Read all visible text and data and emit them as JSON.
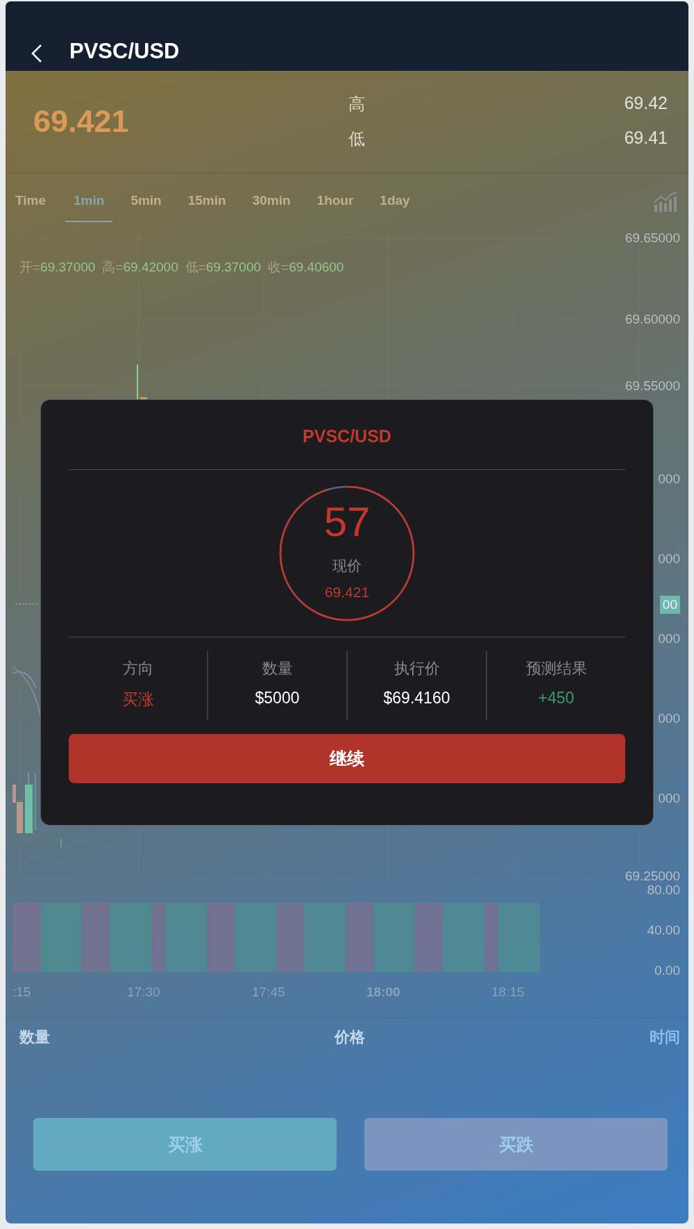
{
  "header": {
    "title": "PVSC/USD"
  },
  "quote": {
    "price": "69.421",
    "high_label": "高",
    "high": "69.42",
    "low_label": "低",
    "low": "69.41"
  },
  "intervals": [
    {
      "label": "Time",
      "selected": false
    },
    {
      "label": "1min",
      "selected": true
    },
    {
      "label": "5min",
      "selected": false
    },
    {
      "label": "15min",
      "selected": false
    },
    {
      "label": "30min",
      "selected": false
    },
    {
      "label": "1hour",
      "selected": false
    },
    {
      "label": "1day",
      "selected": false
    }
  ],
  "ohlc": [
    {
      "label": "开=",
      "value": "69.37000"
    },
    {
      "label": "高=",
      "value": "69.42000"
    },
    {
      "label": "低=",
      "value": "69.37000"
    },
    {
      "label": "收=",
      "value": "69.40600"
    }
  ],
  "price_axis": [
    "69.65000",
    "69.60000",
    "69.55000",
    "000",
    "000",
    "000",
    "000",
    "000",
    "69.25000"
  ],
  "current_price_tag": "00",
  "volume_axis": [
    "80.00",
    "40.00",
    "0.00"
  ],
  "time_axis": [
    {
      "label": ":15",
      "emphasized": false
    },
    {
      "label": "17:30",
      "emphasized": false
    },
    {
      "label": "17:45",
      "emphasized": false
    },
    {
      "label": "18:00",
      "emphasized": true
    },
    {
      "label": "18:15",
      "emphasized": false
    }
  ],
  "trades_table": {
    "columns": [
      "数量",
      "价格",
      "时间"
    ]
  },
  "actions": [
    {
      "label": "买涨",
      "kind": "up"
    },
    {
      "label": "买跌",
      "kind": "down"
    }
  ],
  "dialog": {
    "title": "PVSC/USD",
    "countdown": "57",
    "level": 0.95,
    "price_label": "现价",
    "price": "69.421",
    "stats": [
      {
        "label": "方向",
        "value": "买涨",
        "kind": "up"
      },
      {
        "label": "数量",
        "value": "$5000",
        "kind": "plain"
      },
      {
        "label": "执行价",
        "value": "$69.4160",
        "kind": "plain"
      },
      {
        "label": "预测结果",
        "value": "+450",
        "kind": "gain"
      }
    ],
    "button": "继续"
  }
}
